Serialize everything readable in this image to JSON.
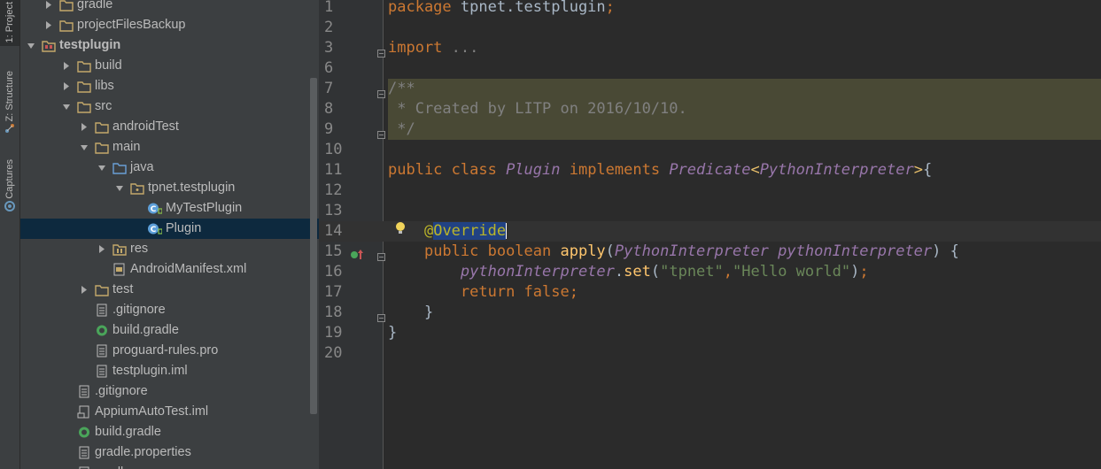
{
  "side_tabs": [
    {
      "label": "1: Project",
      "icon": "android-icon"
    },
    {
      "label": "Z: Structure",
      "icon": "structure-icon"
    },
    {
      "label": "Captures",
      "icon": "captures-icon"
    }
  ],
  "tree": [
    {
      "label": "gradle",
      "icon": "folder",
      "depth": 2,
      "arrow": "right"
    },
    {
      "label": "projectFilesBackup",
      "icon": "folder",
      "depth": 2,
      "arrow": "right"
    },
    {
      "label": "testplugin",
      "icon": "module",
      "depth": 1,
      "arrow": "down",
      "bold": true
    },
    {
      "label": "build",
      "icon": "folder",
      "depth": 3,
      "arrow": "right"
    },
    {
      "label": "libs",
      "icon": "folder",
      "depth": 3,
      "arrow": "right"
    },
    {
      "label": "src",
      "icon": "folder",
      "depth": 3,
      "arrow": "down"
    },
    {
      "label": "androidTest",
      "icon": "folder",
      "depth": 4,
      "arrow": "right"
    },
    {
      "label": "main",
      "icon": "folder",
      "depth": 4,
      "arrow": "down"
    },
    {
      "label": "java",
      "icon": "source-folder",
      "depth": 5,
      "arrow": "down"
    },
    {
      "label": "tpnet.testplugin",
      "icon": "package",
      "depth": 6,
      "arrow": "down"
    },
    {
      "label": "MyTestPlugin",
      "icon": "class",
      "depth": 7,
      "arrow": ""
    },
    {
      "label": "Plugin",
      "icon": "class",
      "depth": 7,
      "arrow": "",
      "selected": true
    },
    {
      "label": "res",
      "icon": "res-folder",
      "depth": 5,
      "arrow": "right"
    },
    {
      "label": "AndroidManifest.xml",
      "icon": "xml-file",
      "depth": 5,
      "arrow": ""
    },
    {
      "label": "test",
      "icon": "folder",
      "depth": 4,
      "arrow": "right"
    },
    {
      "label": ".gitignore",
      "icon": "text-file",
      "depth": 4,
      "arrow": ""
    },
    {
      "label": "build.gradle",
      "icon": "gradle-file",
      "depth": 4,
      "arrow": ""
    },
    {
      "label": "proguard-rules.pro",
      "icon": "text-file",
      "depth": 4,
      "arrow": ""
    },
    {
      "label": "testplugin.iml",
      "icon": "text-file",
      "depth": 4,
      "arrow": ""
    },
    {
      "label": ".gitignore",
      "icon": "text-file",
      "depth": 3,
      "arrow": ""
    },
    {
      "label": "AppiumAutoTest.iml",
      "icon": "iml-file",
      "depth": 3,
      "arrow": ""
    },
    {
      "label": "build.gradle",
      "icon": "gradle-file",
      "depth": 3,
      "arrow": ""
    },
    {
      "label": "gradle.properties",
      "icon": "text-file",
      "depth": 3,
      "arrow": ""
    },
    {
      "label": "gradlew",
      "icon": "text-file",
      "depth": 3,
      "arrow": ""
    }
  ],
  "editor": {
    "lines": [
      {
        "num": "1",
        "tokens": [
          [
            "kw",
            "package "
          ],
          [
            "plain",
            "tpnet.testplugin"
          ],
          [
            "kw",
            ";"
          ]
        ]
      },
      {
        "num": "2",
        "tokens": []
      },
      {
        "num": "3",
        "tokens": [
          [
            "kw",
            "import "
          ],
          [
            "cmt",
            "..."
          ]
        ]
      },
      {
        "num": "6",
        "tokens": []
      },
      {
        "num": "7",
        "tokens": [
          [
            "cmt",
            "/**"
          ]
        ],
        "doc": true
      },
      {
        "num": "8",
        "tokens": [
          [
            "cmt",
            " * Created by LITP on 2016/10/10."
          ]
        ],
        "doc": true
      },
      {
        "num": "9",
        "tokens": [
          [
            "cmt",
            " */"
          ]
        ],
        "doc": true
      },
      {
        "num": "10",
        "tokens": []
      },
      {
        "num": "11",
        "tokens": [
          [
            "kw",
            "public class "
          ],
          [
            "it",
            "Plugin"
          ],
          [
            "kw",
            " implements "
          ],
          [
            "it2",
            "Predicate"
          ],
          [
            "brk",
            "<"
          ],
          [
            "it2",
            "PythonInterpreter"
          ],
          [
            "brk",
            ">"
          ],
          [
            "plain",
            "{"
          ]
        ]
      },
      {
        "num": "12",
        "tokens": []
      },
      {
        "num": "13",
        "tokens": []
      },
      {
        "num": "14",
        "tokens": [
          [
            "plain",
            "    "
          ],
          [
            "ann",
            "@"
          ],
          [
            "sel",
            "Override"
          ],
          [
            "caret",
            ""
          ]
        ],
        "current": true
      },
      {
        "num": "15",
        "tokens": [
          [
            "plain",
            "    "
          ],
          [
            "kw",
            "public boolean "
          ],
          [
            "fn",
            "apply"
          ],
          [
            "plain",
            "("
          ],
          [
            "it2",
            "PythonInterpreter "
          ],
          [
            "it",
            "pythonInterpreter"
          ],
          [
            "plain",
            ") {"
          ]
        ]
      },
      {
        "num": "16",
        "tokens": [
          [
            "plain",
            "        "
          ],
          [
            "it",
            "pythonInterpreter"
          ],
          [
            "plain",
            "."
          ],
          [
            "fn",
            "set"
          ],
          [
            "plain",
            "("
          ],
          [
            "str",
            "\"tpnet\""
          ],
          [
            "kw",
            ","
          ],
          [
            "str",
            "\"Hello world\""
          ],
          [
            "plain",
            ")"
          ],
          [
            "kw",
            ";"
          ]
        ]
      },
      {
        "num": "17",
        "tokens": [
          [
            "plain",
            "        "
          ],
          [
            "kw",
            "return false;"
          ]
        ]
      },
      {
        "num": "18",
        "tokens": [
          [
            "plain",
            "    }"
          ]
        ]
      },
      {
        "num": "19",
        "tokens": [
          [
            "plain",
            "}"
          ]
        ]
      },
      {
        "num": "20",
        "tokens": []
      }
    ]
  }
}
